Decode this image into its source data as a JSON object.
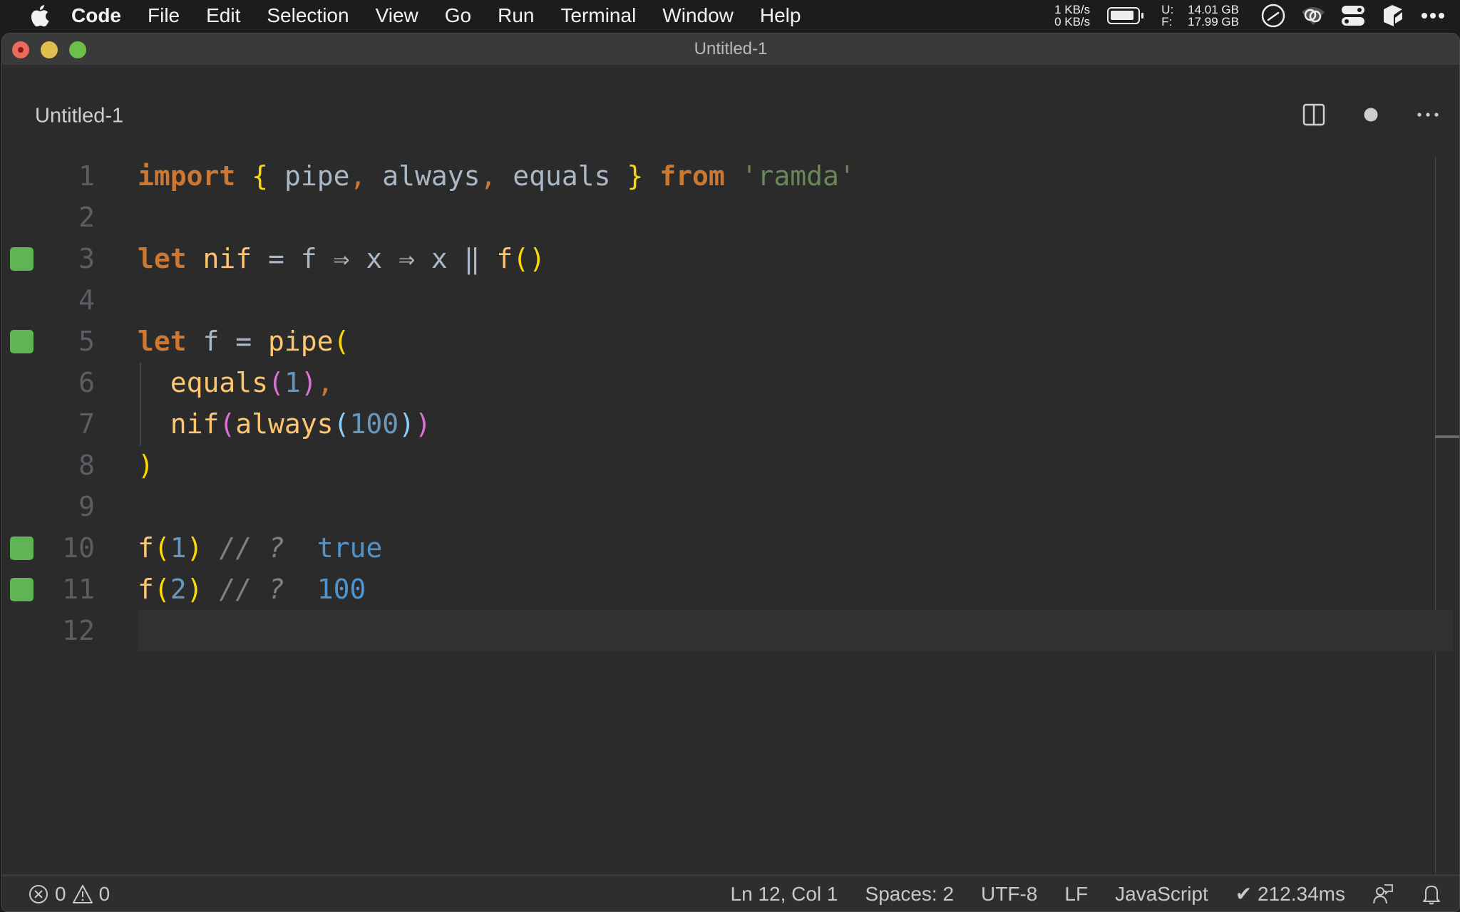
{
  "menubar": {
    "app_name": "Code",
    "items": [
      "File",
      "Edit",
      "Selection",
      "View",
      "Go",
      "Run",
      "Terminal",
      "Window",
      "Help"
    ],
    "net_up": "1 KB/s",
    "net_down": "0 KB/s",
    "disk_used_label": "U:",
    "disk_free_label": "F:",
    "disk_used": "14.01 GB",
    "disk_free": "17.99 GB",
    "tray_icons": [
      "speedometer-icon",
      "creative-cloud-icon",
      "control-center-icon",
      "app-icon",
      "more-icon"
    ]
  },
  "window": {
    "title": "Untitled-1"
  },
  "tab": {
    "title": "Untitled-1",
    "actions": [
      "split-editor-icon",
      "unsaved-dot-icon",
      "more-actions-icon"
    ]
  },
  "editor": {
    "lines": [
      {
        "n": "1",
        "marker": false,
        "tokens": [
          {
            "t": "import",
            "c": "kw"
          },
          {
            "t": " ",
            "c": "id"
          },
          {
            "t": "{",
            "c": "b1"
          },
          {
            "t": " pipe",
            "c": "id"
          },
          {
            "t": ",",
            "c": "punc"
          },
          {
            "t": " always",
            "c": "id"
          },
          {
            "t": ",",
            "c": "punc"
          },
          {
            "t": " equals ",
            "c": "id"
          },
          {
            "t": "}",
            "c": "b1"
          },
          {
            "t": " ",
            "c": "id"
          },
          {
            "t": "from",
            "c": "kw"
          },
          {
            "t": " ",
            "c": "id"
          },
          {
            "t": "'ramda'",
            "c": "str"
          }
        ]
      },
      {
        "n": "2",
        "marker": false,
        "tokens": []
      },
      {
        "n": "3",
        "marker": true,
        "tokens": [
          {
            "t": "let",
            "c": "kw"
          },
          {
            "t": " ",
            "c": "id"
          },
          {
            "t": "nif",
            "c": "fn"
          },
          {
            "t": " = f ⇒ x ⇒ x ‖ ",
            "c": "op"
          },
          {
            "t": "f",
            "c": "fn"
          },
          {
            "t": "(",
            "c": "b1"
          },
          {
            "t": ")",
            "c": "b1"
          }
        ]
      },
      {
        "n": "4",
        "marker": false,
        "tokens": []
      },
      {
        "n": "5",
        "marker": true,
        "tokens": [
          {
            "t": "let",
            "c": "kw"
          },
          {
            "t": " f = ",
            "c": "id"
          },
          {
            "t": "pipe",
            "c": "fn"
          },
          {
            "t": "(",
            "c": "b1"
          }
        ]
      },
      {
        "n": "6",
        "marker": false,
        "tokens": [
          {
            "t": "  ",
            "c": "id"
          },
          {
            "t": "equals",
            "c": "fn"
          },
          {
            "t": "(",
            "c": "b2"
          },
          {
            "t": "1",
            "c": "num"
          },
          {
            "t": ")",
            "c": "b2"
          },
          {
            "t": ",",
            "c": "punc"
          }
        ]
      },
      {
        "n": "7",
        "marker": false,
        "tokens": [
          {
            "t": "  ",
            "c": "id"
          },
          {
            "t": "nif",
            "c": "fn"
          },
          {
            "t": "(",
            "c": "b2"
          },
          {
            "t": "always",
            "c": "fn"
          },
          {
            "t": "(",
            "c": "b3"
          },
          {
            "t": "100",
            "c": "num"
          },
          {
            "t": ")",
            "c": "b3"
          },
          {
            "t": ")",
            "c": "b2"
          }
        ]
      },
      {
        "n": "8",
        "marker": false,
        "tokens": [
          {
            "t": ")",
            "c": "b1"
          }
        ]
      },
      {
        "n": "9",
        "marker": false,
        "tokens": []
      },
      {
        "n": "10",
        "marker": true,
        "tokens": [
          {
            "t": "f",
            "c": "fn"
          },
          {
            "t": "(",
            "c": "b1"
          },
          {
            "t": "1",
            "c": "num"
          },
          {
            "t": ")",
            "c": "b1"
          },
          {
            "t": " // ?  ",
            "c": "cmt"
          },
          {
            "t": "true",
            "c": "res"
          }
        ]
      },
      {
        "n": "11",
        "marker": true,
        "tokens": [
          {
            "t": "f",
            "c": "fn"
          },
          {
            "t": "(",
            "c": "b1"
          },
          {
            "t": "2",
            "c": "num"
          },
          {
            "t": ")",
            "c": "b1"
          },
          {
            "t": " // ?  ",
            "c": "cmt"
          },
          {
            "t": "100",
            "c": "res"
          }
        ]
      },
      {
        "n": "12",
        "marker": false,
        "current": true,
        "tokens": []
      }
    ]
  },
  "statusbar": {
    "errors": "0",
    "warnings": "0",
    "cursor": "Ln 12, Col 1",
    "indent": "Spaces: 2",
    "encoding": "UTF-8",
    "eol": "LF",
    "language": "JavaScript",
    "timing": "✔ 212.34ms"
  },
  "colors": {
    "marker_green": "#5fb554",
    "keyword": "#cc7832",
    "function": "#ffc66d",
    "identifier": "#a9b7c6",
    "string": "#6a8759",
    "number": "#6897bb",
    "result": "#4e94ce",
    "bracket_1": "#ffd700",
    "bracket_2": "#da70d6",
    "bracket_3": "#87cefa"
  }
}
